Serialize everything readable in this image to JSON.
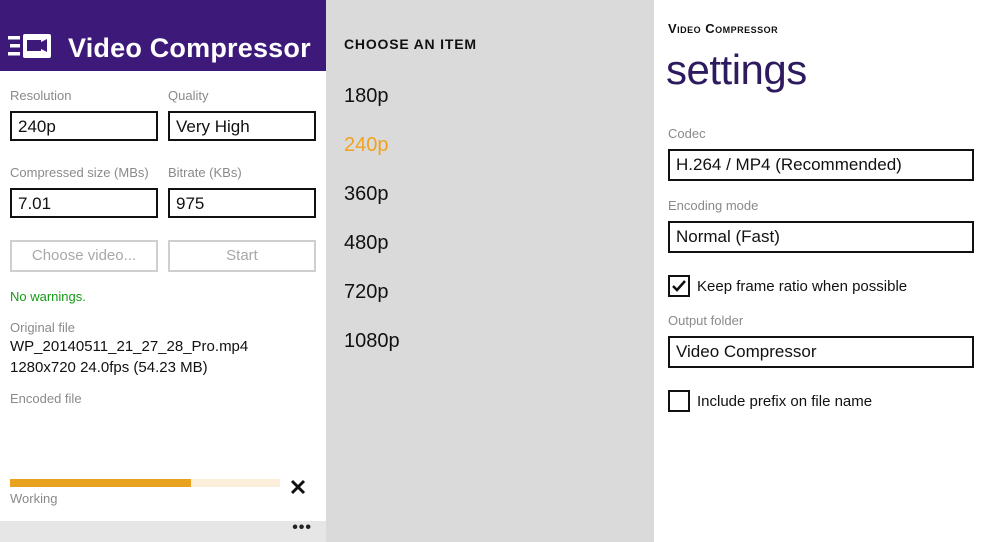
{
  "main": {
    "app_title": "Video Compressor",
    "resolution_label": "Resolution",
    "resolution_value": "240p",
    "quality_label": "Quality",
    "quality_value": "Very High",
    "size_label": "Compressed size (MBs)",
    "size_value": "7.01",
    "bitrate_label": "Bitrate (KBs)",
    "bitrate_value": "975",
    "choose_button": "Choose video...",
    "start_button": "Start",
    "warnings": "No warnings.",
    "original_label": "Original file",
    "original_name": "WP_20140511_21_27_28_Pro.mp4",
    "original_info": "1280x720 24.0fps (54.23 MB)",
    "encoded_label": "Encoded file",
    "progress_fraction": 0.67,
    "status": "Working",
    "more": "•••"
  },
  "picker": {
    "heading": "CHOOSE AN ITEM",
    "items": [
      "180p",
      "240p",
      "360p",
      "480p",
      "720p",
      "1080p"
    ],
    "selected": "240p"
  },
  "settings": {
    "app_name": "Video Compressor",
    "title": "settings",
    "codec_label": "Codec",
    "codec_value": "H.264 / MP4 (Recommended)",
    "encoding_label": "Encoding mode",
    "encoding_value": "Normal (Fast)",
    "keep_ratio_label": "Keep frame ratio when possible",
    "keep_ratio_checked": true,
    "output_label": "Output folder",
    "output_value": "Video Compressor",
    "prefix_label": "Include prefix on file name",
    "prefix_checked": false
  },
  "colors": {
    "header": "#3d1a7a",
    "accent": "#f0a21e",
    "progress": "#e8a21e",
    "success": "#169a16"
  }
}
